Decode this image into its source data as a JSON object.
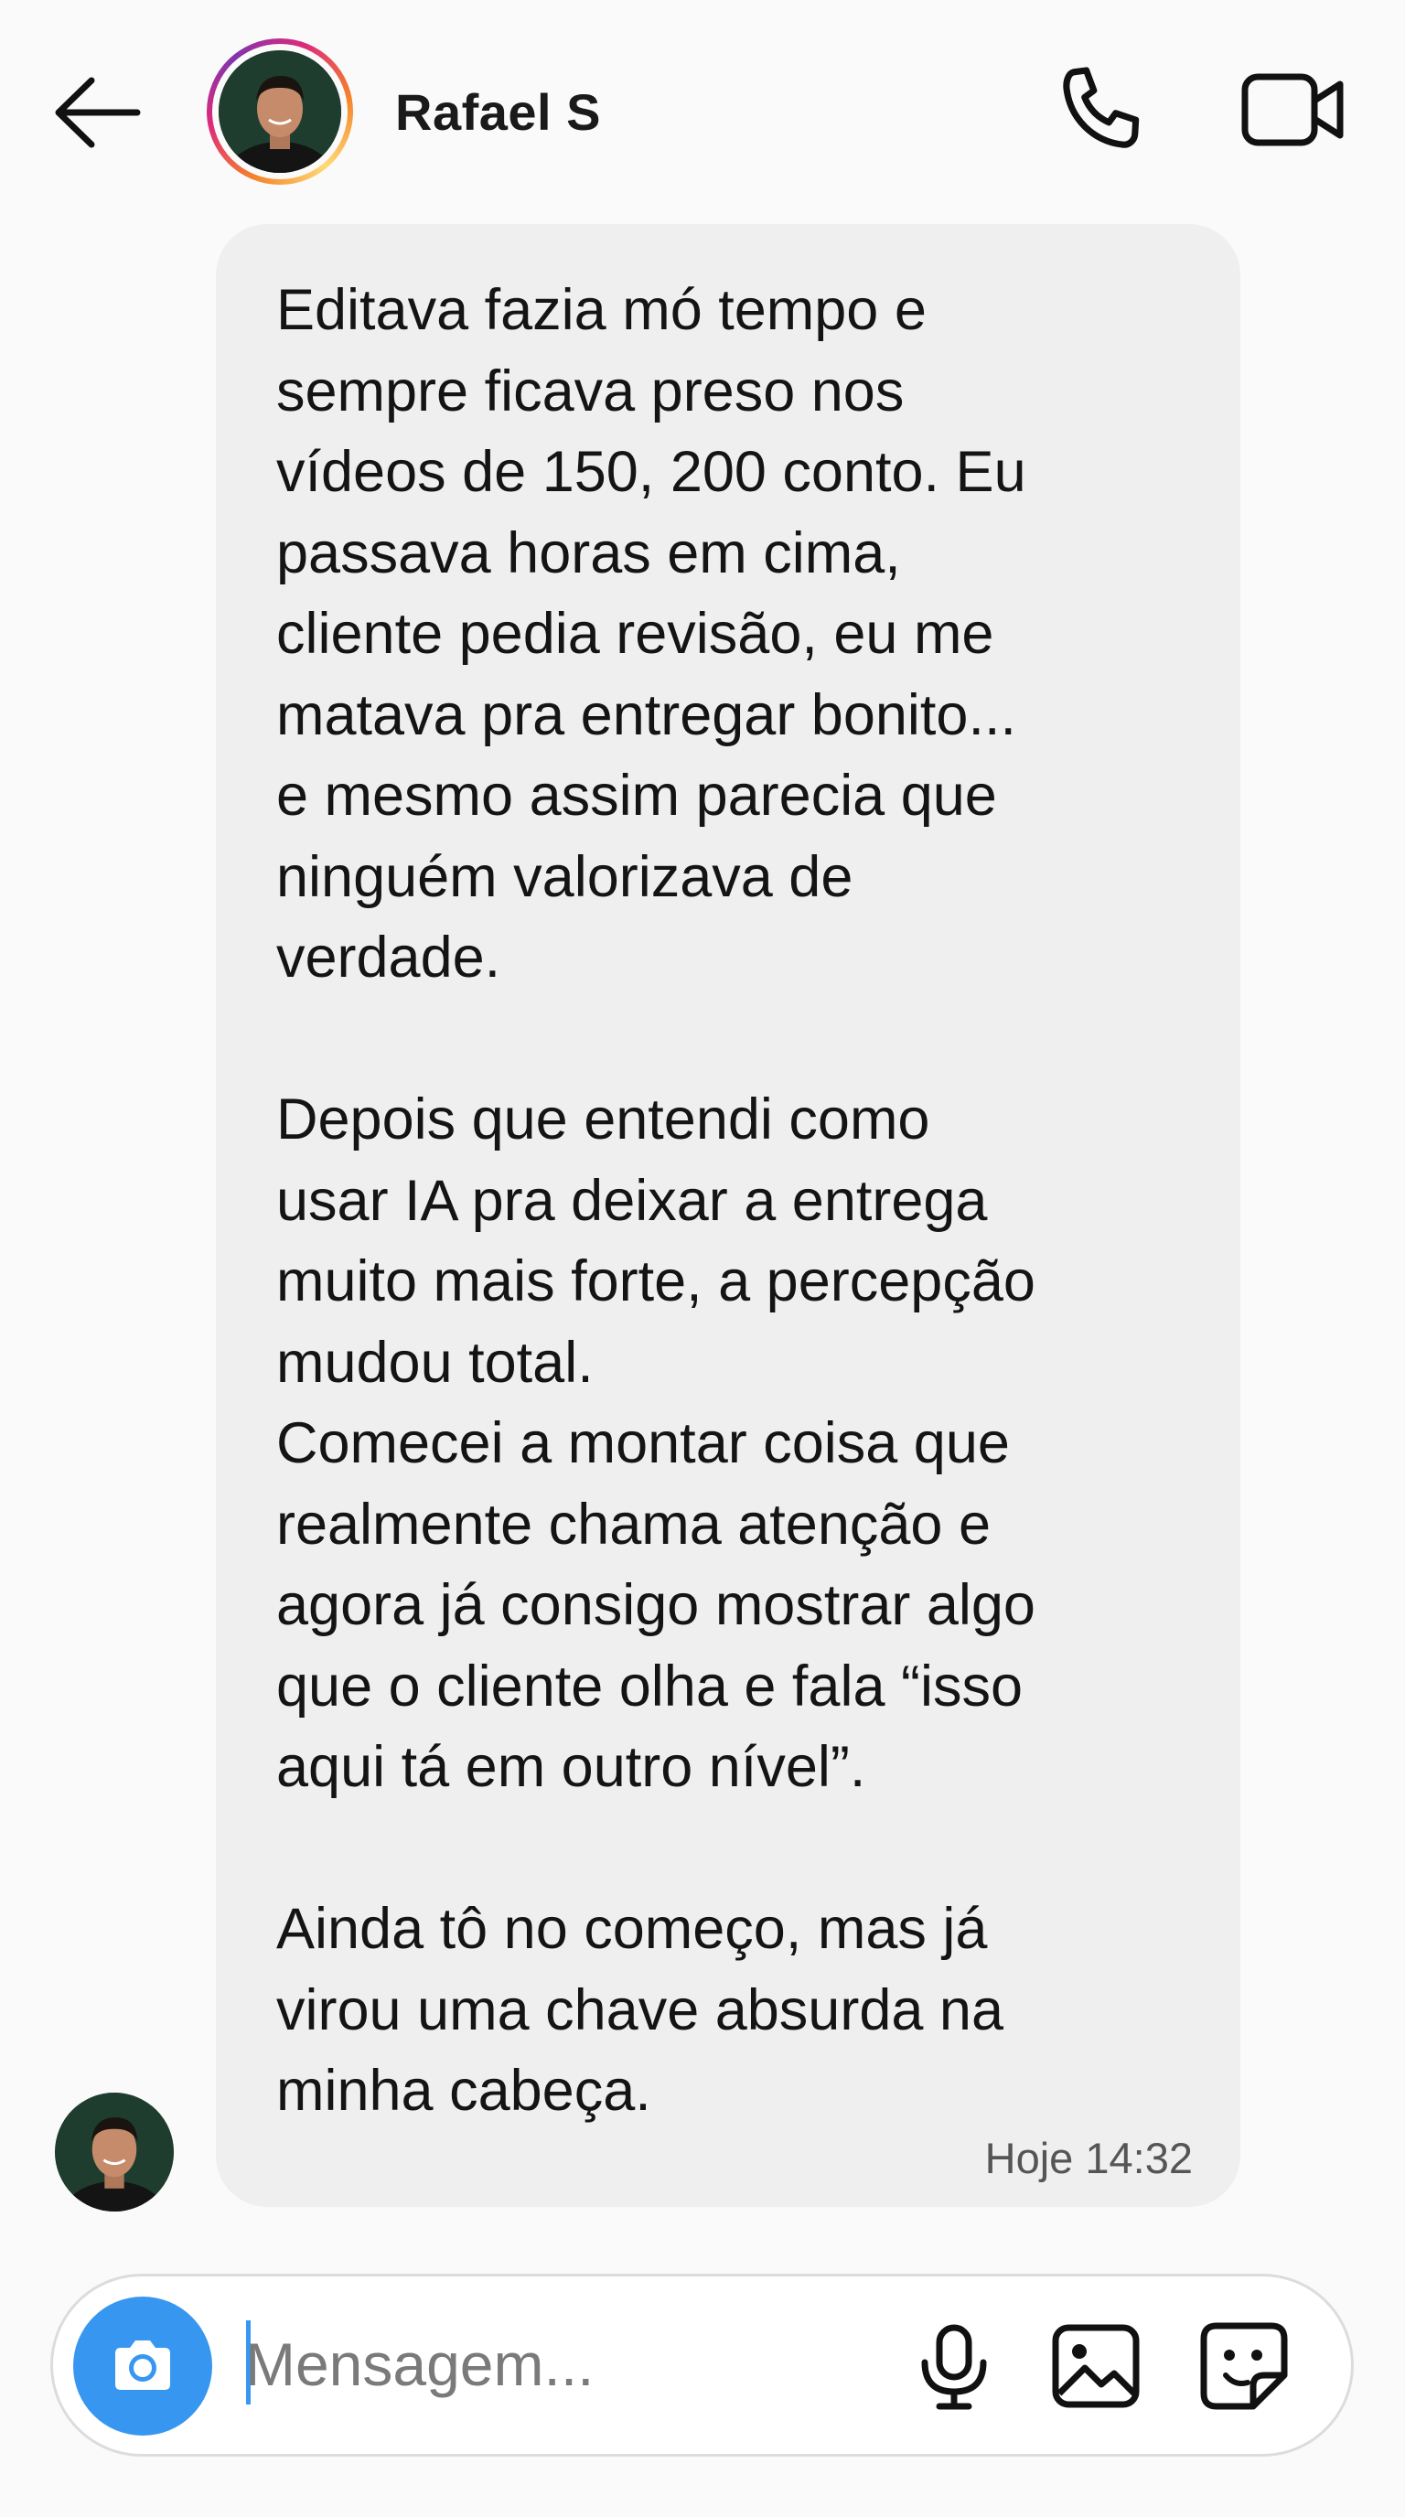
{
  "header": {
    "contact_name": "Rafael S",
    "back_icon": "arrow-left-icon",
    "call_icon": "phone-icon",
    "video_icon": "video-camera-icon"
  },
  "message": {
    "paragraphs": [
      "Editava fazia mó tempo e\nsempre ficava preso nos\nvídeos de 150, 200 conto. Eu\npassava horas em cima,\ncliente pedia revisão, eu me\nmatava pra entregar bonito...\ne mesmo assim parecia que\nninguém valorizava de\nverdade.",
      "Depois que entendi como\nusar IA pra deixar a entrega\nmuito mais forte, a percepção\nmudou total.\nComecei a montar coisa que\nrealmente chama atenção e\nagora já consigo mostrar algo\nque o cliente olha e fala “isso\naqui tá em outro nível”.",
      "Ainda tô no começo, mas já\nvirou uma chave absurda na\nminha cabeça."
    ],
    "timestamp": "Hoje 14:32"
  },
  "composer": {
    "placeholder": "Mensagem...",
    "camera_icon": "camera-icon",
    "mic_icon": "microphone-icon",
    "gallery_icon": "image-icon",
    "sticker_icon": "sticker-icon"
  },
  "colors": {
    "accent": "#3797f0",
    "bubble": "#efeff0",
    "background": "#fafafa",
    "story_ring": [
      "#f58529",
      "#dd2a7b",
      "#8134af",
      "#feda77"
    ]
  }
}
